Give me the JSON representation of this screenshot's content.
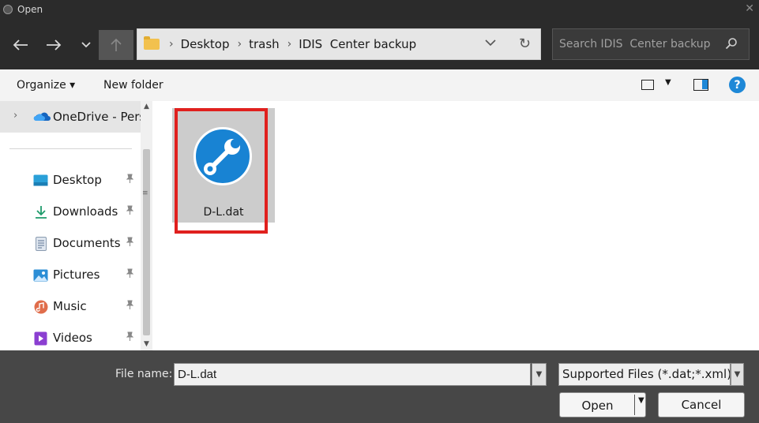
{
  "window": {
    "title": "Open",
    "close_glyph": "✕"
  },
  "nav": {
    "back_glyph": "←",
    "forward_glyph": "→",
    "recent_glyph": "⌄",
    "up_glyph": "↑",
    "breadcrumb": [
      "Desktop",
      "trash",
      "IDIS  Center backup"
    ],
    "address_dropdown_glyph": "⌄",
    "refresh_glyph": "↻",
    "search_placeholder": "Search IDIS  Center backup"
  },
  "commands": {
    "organize": "Organize ▾",
    "new_folder": "New folder",
    "view_arrow": "▼",
    "help": "?"
  },
  "sidebar": {
    "onedrive": "OneDrive - Perso",
    "items": [
      {
        "label": "Desktop",
        "icon": "desktop-icon"
      },
      {
        "label": "Downloads",
        "icon": "download-icon"
      },
      {
        "label": "Documents",
        "icon": "documents-icon"
      },
      {
        "label": "Pictures",
        "icon": "pictures-icon"
      },
      {
        "label": "Music",
        "icon": "music-icon"
      },
      {
        "label": "Videos",
        "icon": "videos-icon"
      }
    ],
    "pin_glyph": "📌"
  },
  "files": [
    {
      "name": "D-L.dat",
      "icon": "wrench-icon",
      "selected": true
    }
  ],
  "footer": {
    "file_name_label": "File name:",
    "file_name_value": "D-L.dat",
    "file_type": "Supported Files (*.dat;*.xml)",
    "open_label": "Open",
    "cancel_label": "Cancel"
  },
  "colors": {
    "accent": "#1e88d7",
    "highlight_box": "#e0201e",
    "chrome_dark": "#2b2b2b",
    "footer_bg": "#474747"
  }
}
